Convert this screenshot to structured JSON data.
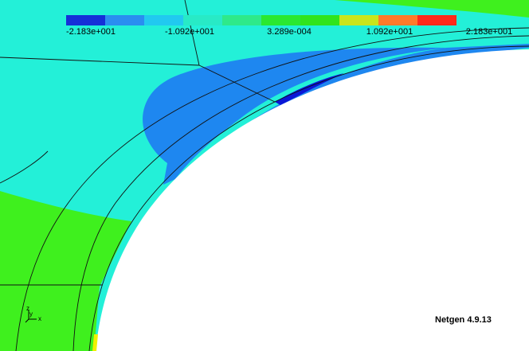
{
  "app": {
    "version_label": "Netgen 4.9.13"
  },
  "colorbar": {
    "colors": [
      "#1530d8",
      "#2a8ef0",
      "#21c9f0",
      "#28eac6",
      "#2ee98a",
      "#2ae830",
      "#30e41c",
      "#c9e51c",
      "#ff7a2a",
      "#ff2a1a"
    ],
    "tick_labels": [
      "-2.183e+001",
      "-1.092e+001",
      "3.289e-004",
      "1.092e+001",
      "2.183e+001"
    ]
  },
  "axes_triad": {
    "x_label": "x",
    "y_label": "y",
    "z_label": "z"
  },
  "field_colors": {
    "cyan": "#23f0d8",
    "blue": "#1e87f0",
    "dark_blue": "#0a16d6",
    "green": "#3ff01e",
    "yellow": "#f0f000",
    "mesh": "#111111",
    "hole": "#ffffff"
  }
}
